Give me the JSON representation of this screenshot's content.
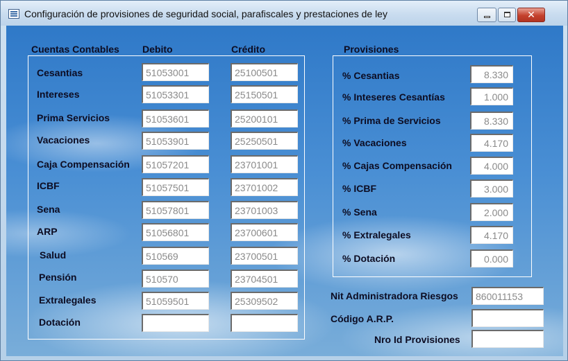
{
  "window": {
    "title": "Configuración de provisiones de seguridad social, parafiscales y prestaciones de ley",
    "close_glyph": "✕"
  },
  "accounts": {
    "headers": {
      "label": "Cuentas Contables",
      "debit": "Debito",
      "credit": "Crédito"
    },
    "rows": [
      {
        "label": "Cesantias",
        "debit": "51053001",
        "credit": "25100501"
      },
      {
        "label": "Intereses",
        "debit": "51053301",
        "credit": "25150501"
      },
      {
        "label": "Prima Servicios",
        "debit": "51053601",
        "credit": "25200101"
      },
      {
        "label": "Vacaciones",
        "debit": "51053901",
        "credit": "25250501"
      },
      {
        "label": "Caja Compensación",
        "debit": "51057201",
        "credit": "23701001"
      },
      {
        "label": "ICBF",
        "debit": "51057501",
        "credit": "23701002"
      },
      {
        "label": "Sena",
        "debit": "51057801",
        "credit": "23701003"
      },
      {
        "label": "ARP",
        "debit": "51056801",
        "credit": "23700601"
      },
      {
        "label": "Salud",
        "debit": "510569",
        "credit": "23700501"
      },
      {
        "label": "Pensión",
        "debit": "510570",
        "credit": "23704501"
      },
      {
        "label": "Extralegales",
        "debit": "51059501",
        "credit": "25309502"
      },
      {
        "label": "Dotación",
        "debit": "",
        "credit": ""
      }
    ]
  },
  "provisions": {
    "header": "Provisiones",
    "rows": [
      {
        "label": "% Cesantias",
        "value": "8.330"
      },
      {
        "label": "% Inteseres Cesantías",
        "value": "1.000"
      },
      {
        "label": "% Prima de Servicios",
        "value": "8.330"
      },
      {
        "label": "% Vacaciones",
        "value": "4.170"
      },
      {
        "label": "% Cajas Compensación",
        "value": "4.000"
      },
      {
        "label": "% ICBF",
        "value": "3.000"
      },
      {
        "label": "% Sena",
        "value": "2.000"
      },
      {
        "label": "% Extralegales",
        "value": "4.170"
      },
      {
        "label": "% Dotación",
        "value": "0.000"
      }
    ]
  },
  "extra_fields": {
    "nit_label": "Nit Administradora Riesgos",
    "nit_value": "860011153",
    "arp_label": "Código A.R.P.",
    "arp_value": "",
    "nro_label": "Nro Id Provisiones",
    "nro_value": ""
  }
}
